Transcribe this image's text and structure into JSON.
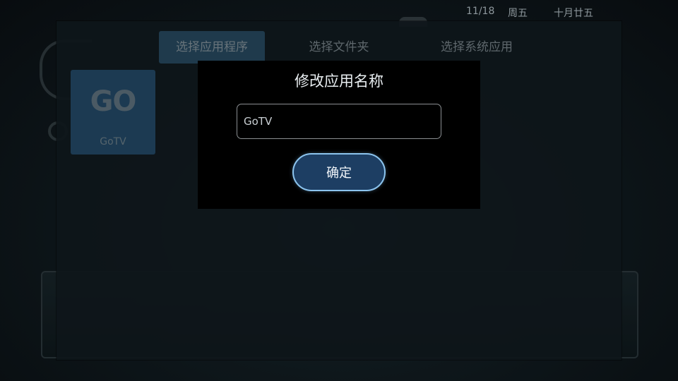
{
  "status_bar": {
    "date": "11/18",
    "weekday": "周五",
    "lunar_date": "十月廿五"
  },
  "picker": {
    "tabs": [
      {
        "label": "选择应用程序",
        "active": true
      },
      {
        "label": "选择文件夹",
        "active": false
      },
      {
        "label": "选择系统应用",
        "active": false
      }
    ],
    "apps": [
      {
        "logo_text": "GO",
        "name": "GoTV"
      }
    ]
  },
  "dialog": {
    "title": "修改应用名称",
    "input_value": "GoTV",
    "confirm_label": "确定"
  },
  "colors": {
    "dialog_background": "#000000",
    "button_fill": "#1d3e63",
    "button_border": "#8cc4ee",
    "active_tab": "#1f3a4c",
    "app_tile": "#1c3a52"
  }
}
